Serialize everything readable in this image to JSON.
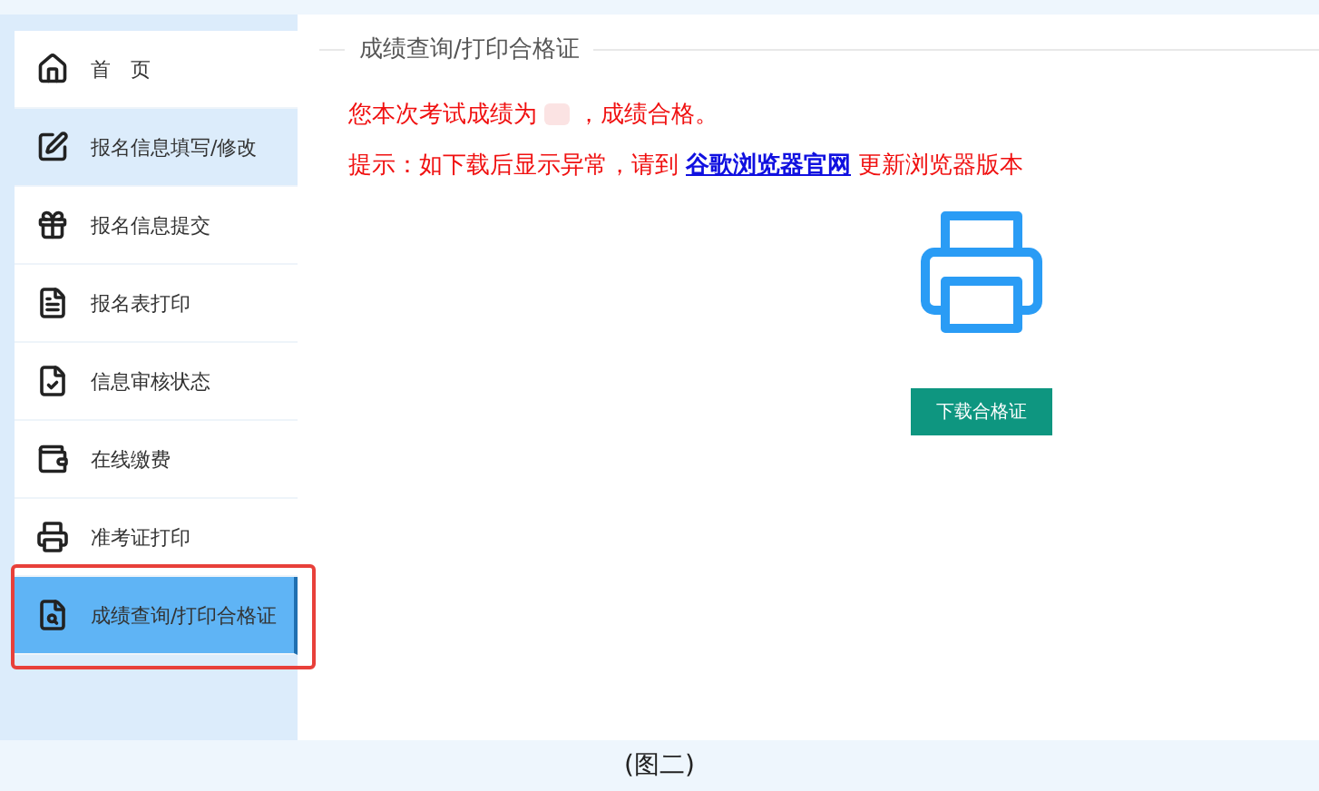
{
  "sidebar": {
    "items": [
      {
        "label": "首　页",
        "selected": false,
        "highlighted": false,
        "annotated": false
      },
      {
        "label": "报名信息填写/修改",
        "selected": false,
        "highlighted": true,
        "annotated": false
      },
      {
        "label": "报名信息提交",
        "selected": false,
        "highlighted": false,
        "annotated": false
      },
      {
        "label": "报名表打印",
        "selected": false,
        "highlighted": false,
        "annotated": false
      },
      {
        "label": "信息审核状态",
        "selected": false,
        "highlighted": false,
        "annotated": false
      },
      {
        "label": "在线缴费",
        "selected": false,
        "highlighted": false,
        "annotated": false
      },
      {
        "label": "准考证打印",
        "selected": false,
        "highlighted": false,
        "annotated": false
      },
      {
        "label": "成绩查询/打印合格证",
        "selected": true,
        "highlighted": false,
        "annotated": true
      }
    ]
  },
  "content": {
    "title": "成绩查询/打印合格证",
    "result": {
      "before": "您本次考试成绩为",
      "after": "，成绩合格。",
      "score_redacted": true
    },
    "hint": {
      "before": "提示：如下载后显示异常，请到",
      "link": "谷歌浏览器官网",
      "after": "更新浏览器版本"
    },
    "download_button": "下载合格证"
  },
  "caption": "(图二)"
}
